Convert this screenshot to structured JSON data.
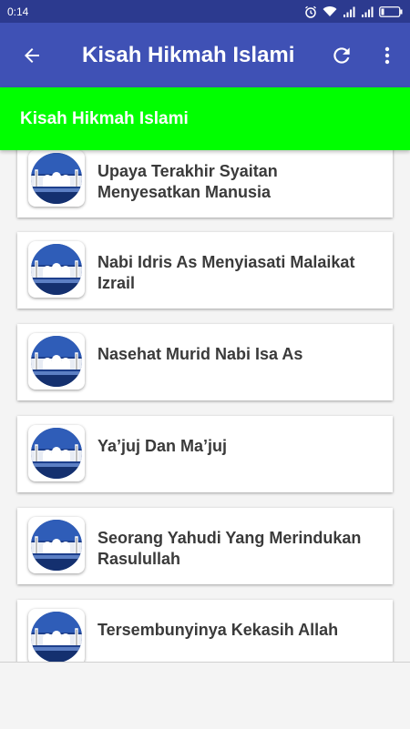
{
  "status_bar": {
    "time": "0:14",
    "icons": [
      "alarm-icon",
      "wifi-icon",
      "signal-icon",
      "signal-icon",
      "battery-icon"
    ]
  },
  "toolbar": {
    "title": "Kisah Hikmah Islami",
    "back_icon": "arrow-back-icon",
    "refresh_icon": "refresh-icon",
    "menu_icon": "more-vert-icon"
  },
  "banner": {
    "text": "Kisah Hikmah Islami",
    "color": "#00ff00"
  },
  "colors": {
    "primary": "#3f51b5",
    "primary_dark": "#2c3a8f",
    "banner": "#00ff00"
  },
  "items": [
    {
      "title": "Upaya Terakhir Syaitan Menyesatkan Manusia",
      "icon": "mosque-thumbnail"
    },
    {
      "title": "Nabi Idris As Menyiasati Malaikat Izrail",
      "icon": "mosque-thumbnail"
    },
    {
      "title": "Nasehat Murid Nabi Isa As",
      "icon": "mosque-thumbnail"
    },
    {
      "title": "Ya’juj Dan Ma’juj",
      "icon": "mosque-thumbnail"
    },
    {
      "title": "Seorang Yahudi Yang Merindukan Rasulullah",
      "icon": "mosque-thumbnail"
    },
    {
      "title": "Tersembunyinya Kekasih Allah",
      "icon": "mosque-thumbnail"
    }
  ]
}
